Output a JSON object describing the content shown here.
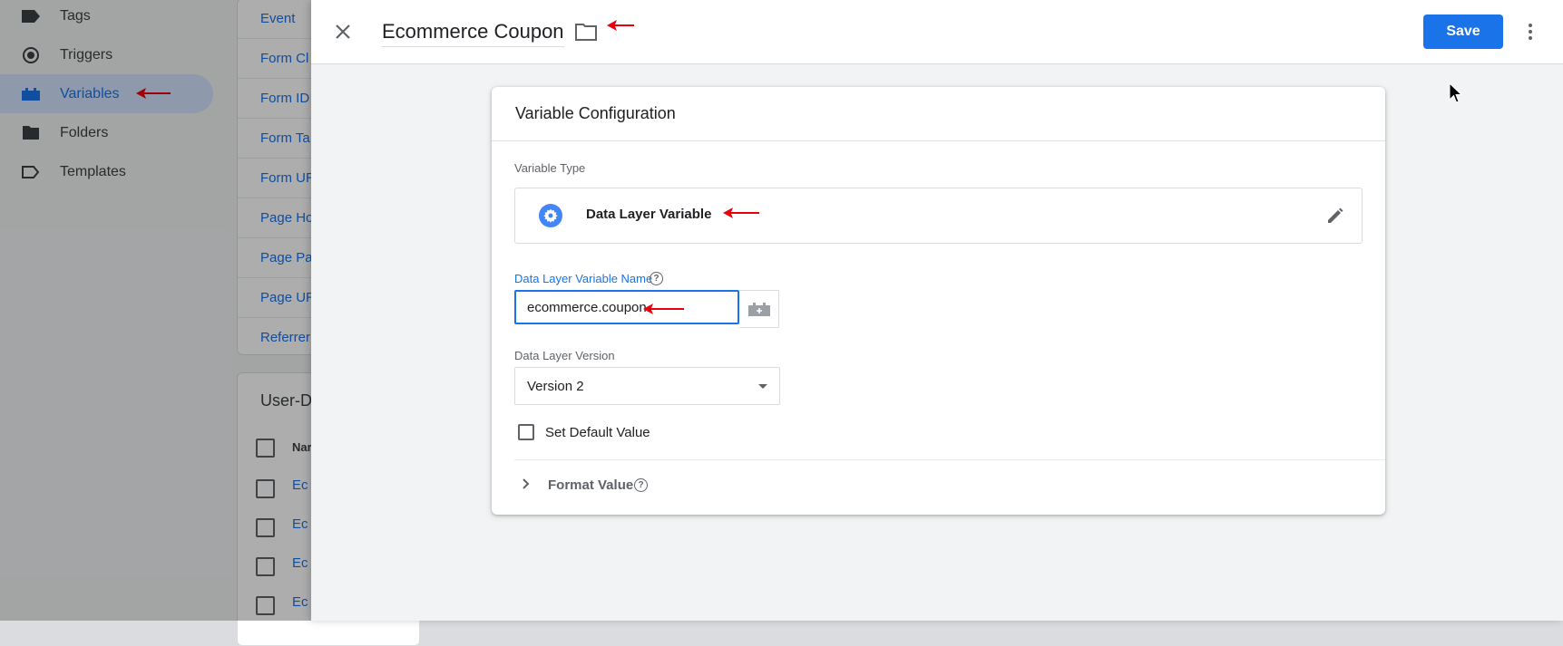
{
  "background": {
    "nav": [
      {
        "label": "Tags",
        "icon": "tag-icon"
      },
      {
        "label": "Triggers",
        "icon": "trigger-icon"
      },
      {
        "label": "Variables",
        "icon": "variables-icon",
        "active": true
      },
      {
        "label": "Folders",
        "icon": "folder-icon"
      },
      {
        "label": "Templates",
        "icon": "template-icon"
      }
    ],
    "builtin_rows": [
      "Event",
      "Form Cl",
      "Form ID",
      "Form Ta",
      "Form UR",
      "Page Ho",
      "Page Pa",
      "Page UR",
      "Referrer"
    ],
    "user_defined": {
      "heading": "User-D",
      "name_header": "Nar",
      "rows": [
        "Ec",
        "Ec",
        "Ec",
        "Ec"
      ]
    }
  },
  "sheet": {
    "title": "Ecommerce Coupon",
    "save_label": "Save"
  },
  "config": {
    "title": "Variable Configuration",
    "type_label": "Variable Type",
    "type_name": "Data Layer Variable",
    "name_label": "Data Layer Variable Name",
    "name_value": "ecommerce.coupon",
    "version_label": "Data Layer Version",
    "version_value": "Version 2",
    "default_label": "Set Default Value",
    "format_label": "Format Value"
  },
  "colors": {
    "accent": "#1a73e8",
    "annotation_arrow": "#e8000b"
  }
}
